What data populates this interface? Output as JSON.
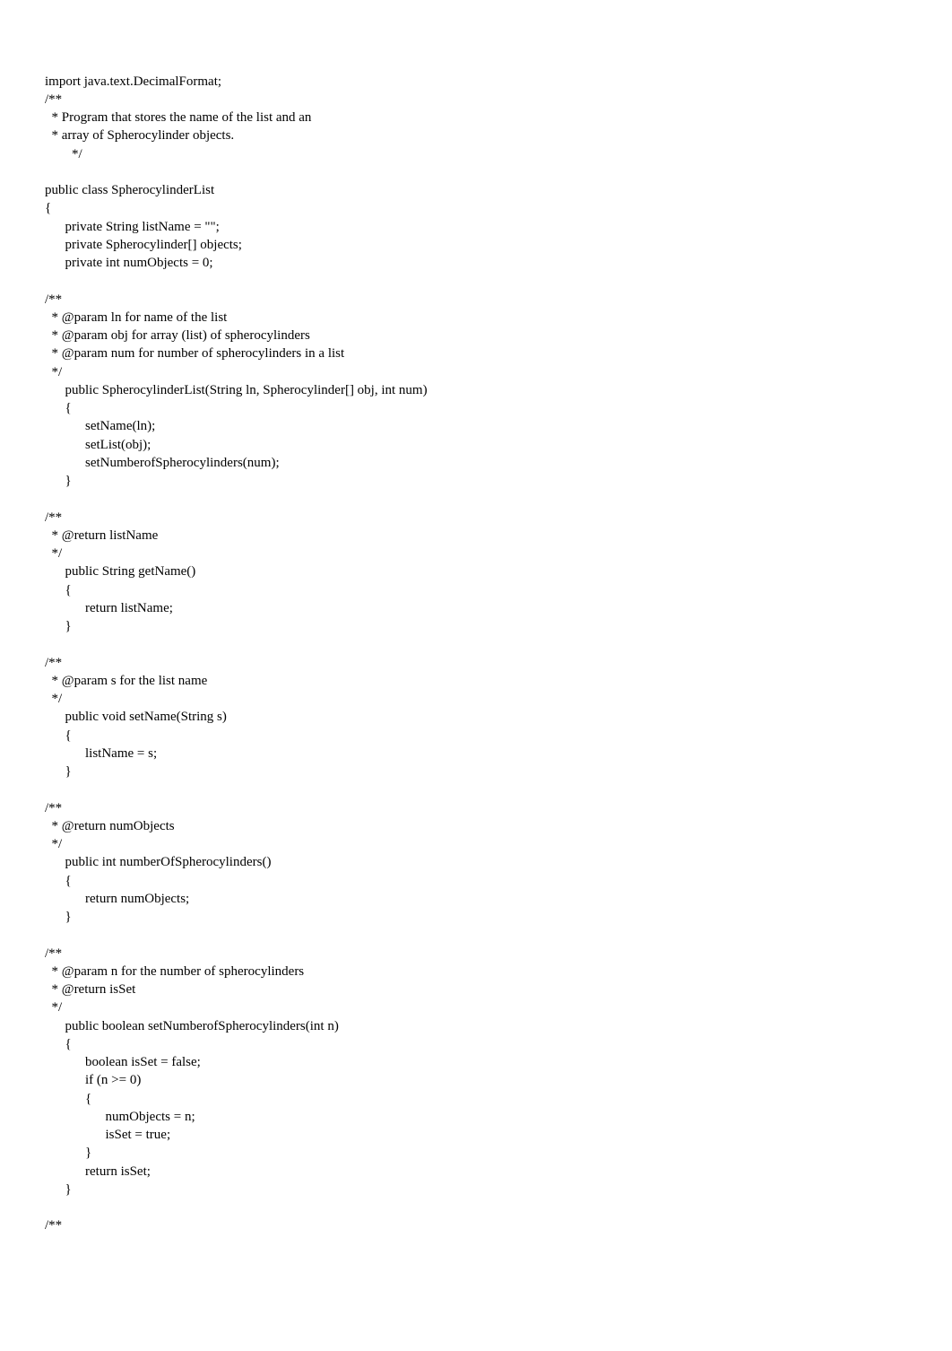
{
  "code": {
    "line1": "import java.text.DecimalFormat;",
    "line2": "/**",
    "line3": "  * Program that stores the name of the list and an",
    "line4": "  * array of Spherocylinder objects.",
    "line5": "        */",
    "line6": "",
    "line7": "public class SpherocylinderList",
    "line8": "{",
    "line9": "      private String listName = \"\";",
    "line10": "      private Spherocylinder[] objects;",
    "line11": "      private int numObjects = 0;",
    "line12": "",
    "line13": "/**",
    "line14": "  * @param ln for name of the list",
    "line15": "  * @param obj for array (list) of spherocylinders",
    "line16": "  * @param num for number of spherocylinders in a list",
    "line17": "  */",
    "line18": "      public SpherocylinderList(String ln, Spherocylinder[] obj, int num)",
    "line19": "      {",
    "line20": "            setName(ln);",
    "line21": "            setList(obj);",
    "line22": "            setNumberofSpherocylinders(num);",
    "line23": "      }",
    "line24": "",
    "line25": "/**",
    "line26": "  * @return listName",
    "line27": "  */",
    "line28": "      public String getName()",
    "line29": "      {",
    "line30": "            return listName;",
    "line31": "      }",
    "line32": "",
    "line33": "/**",
    "line34": "  * @param s for the list name",
    "line35": "  */",
    "line36": "      public void setName(String s)",
    "line37": "      {",
    "line38": "            listName = s;",
    "line39": "      }",
    "line40": "",
    "line41": "/**",
    "line42": "  * @return numObjects",
    "line43": "  */",
    "line44": "      public int numberOfSpherocylinders()",
    "line45": "      {",
    "line46": "            return numObjects;",
    "line47": "      }",
    "line48": "",
    "line49": "/**",
    "line50": "  * @param n for the number of spherocylinders",
    "line51": "  * @return isSet",
    "line52": "  */",
    "line53": "      public boolean setNumberofSpherocylinders(int n)",
    "line54": "      {",
    "line55": "            boolean isSet = false;",
    "line56": "            if (n >= 0)",
    "line57": "            {",
    "line58": "                  numObjects = n;",
    "line59": "                  isSet = true;",
    "line60": "            }",
    "line61": "            return isSet;",
    "line62": "      }",
    "line63": "",
    "line64": "/**"
  }
}
